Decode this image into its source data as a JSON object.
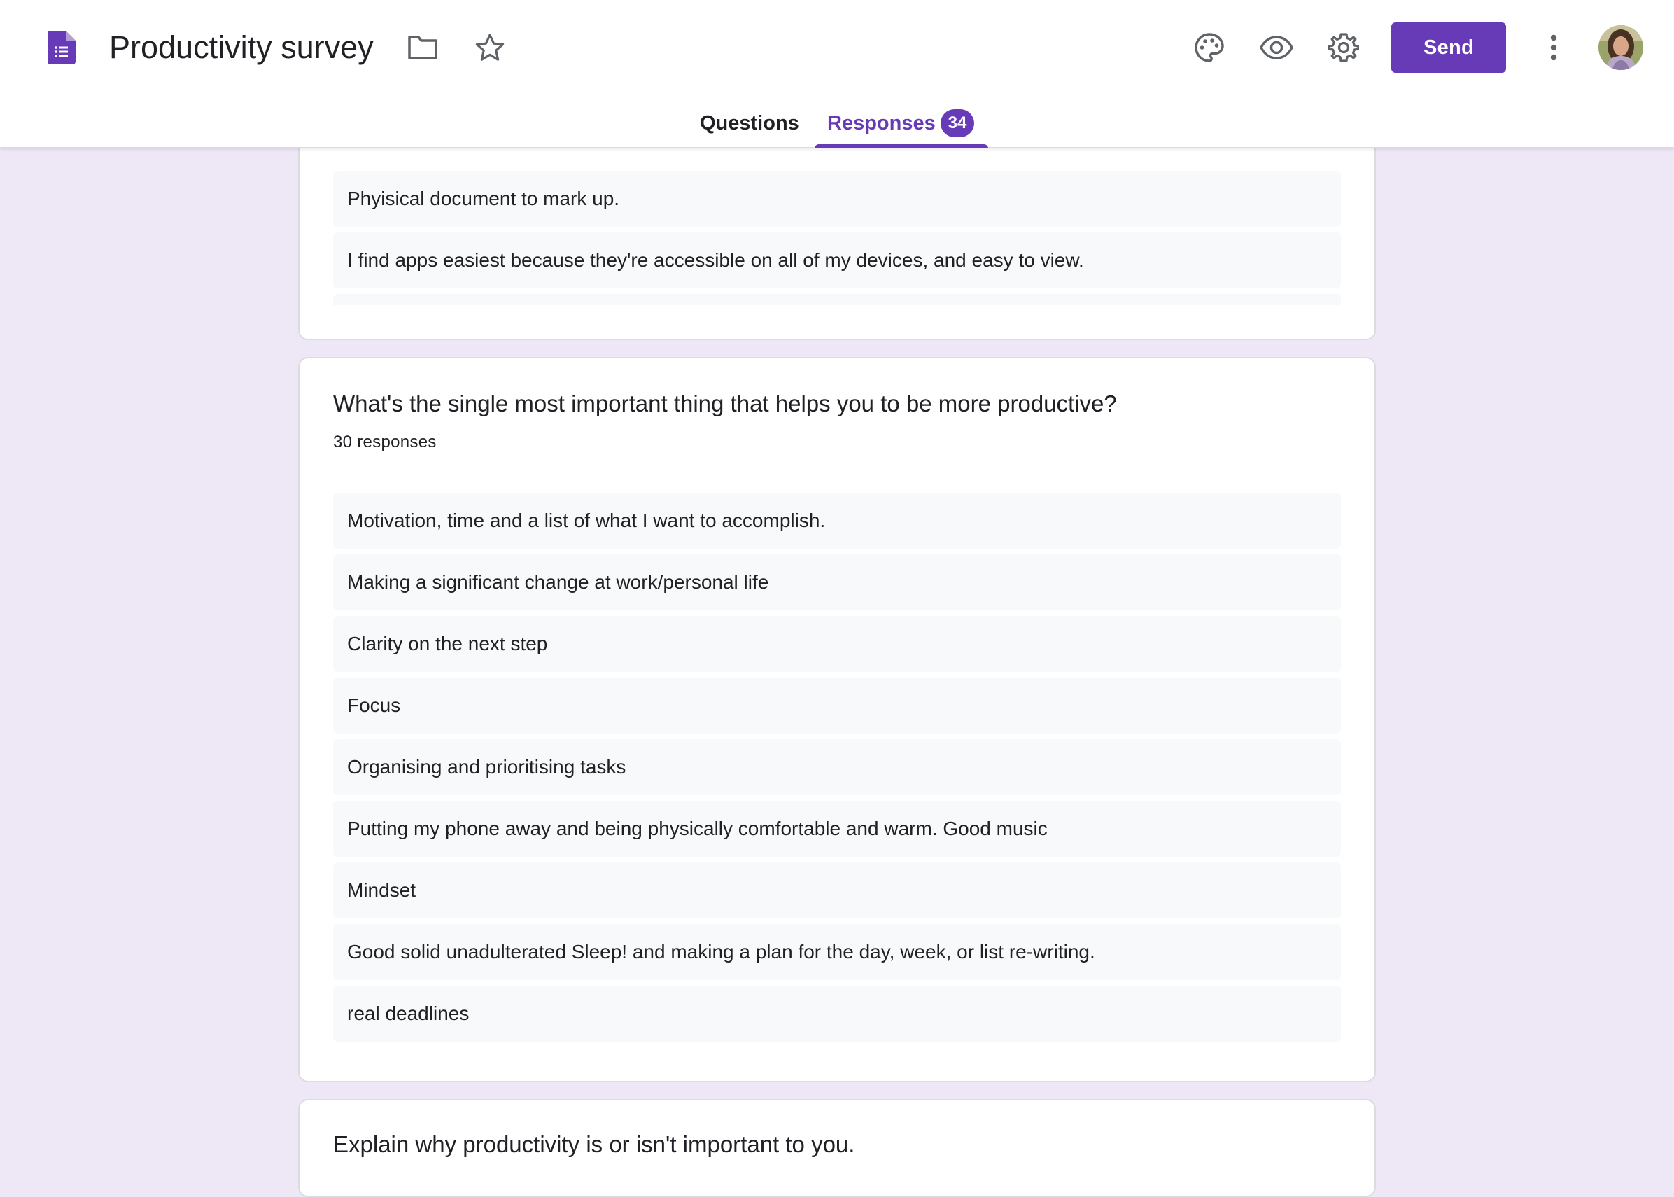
{
  "header": {
    "title": "Productivity survey",
    "send_label": "Send",
    "accent_color": "#673ab7",
    "icons": [
      "forms-logo-icon",
      "folder-icon",
      "star-icon",
      "palette-icon",
      "eye-icon",
      "gear-icon",
      "more-vert-icon",
      "avatar"
    ]
  },
  "tabs": {
    "questions": "Questions",
    "responses": "Responses",
    "responses_count": "34",
    "active": "responses"
  },
  "previous_question": {
    "responses": [
      "Phyisical document to mark up.",
      "I find apps easiest because they're accessible on all of my devices, and easy to view."
    ]
  },
  "main_question": {
    "title": "What's the single most important thing that helps you to be more productive?",
    "count": "30 responses",
    "responses": [
      "Motivation, time and a list of what I want to accomplish.",
      "Making a significant change at work/personal life",
      "Clarity on the next step",
      "Focus",
      "Organising and prioritising tasks",
      "Putting my phone away and being physically comfortable and warm. Good music",
      "Mindset",
      "Good solid unadulterated Sleep! and making a plan for the day, week, or list re-writing.",
      "real deadlines"
    ]
  },
  "next_question": {
    "title": "Explain why productivity is or isn't important to you."
  }
}
